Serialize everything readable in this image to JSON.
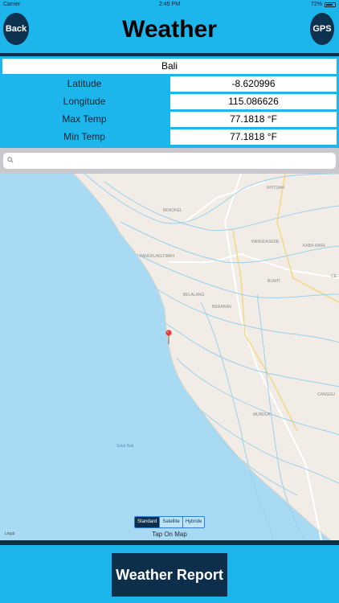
{
  "status_bar": {
    "carrier": "Carrier",
    "time": "2:45 PM",
    "battery": "72%"
  },
  "header": {
    "title": "Weather",
    "back_label": "Back",
    "gps_label": "GPS"
  },
  "location": {
    "name": "Bali"
  },
  "info": {
    "latitude": {
      "label": "Latitude",
      "value": "-8.620996"
    },
    "longitude": {
      "label": "Longitude",
      "value": "115.086626"
    },
    "max_temp": {
      "label": "Max Temp",
      "value": "77.1818 °F"
    },
    "min_temp": {
      "label": "Min Temp",
      "value": "77.1818 °F"
    }
  },
  "search": {
    "placeholder": ""
  },
  "map": {
    "places": [
      "BENOKEL",
      "PANGKUNGTIBAH",
      "BELALANG",
      "BERABAN",
      "NYITDAH",
      "PANGKAGEDE",
      "KABA KABA",
      "BUWIT",
      "MUNDUK",
      "CANGGU",
      "CE"
    ],
    "sea_label": "Selat Bali",
    "legal": "Legal",
    "map_types": [
      "Standard",
      "Satellite",
      "Hybride"
    ],
    "selected_type": "Standard",
    "hint": "Tap On Map"
  },
  "footer": {
    "report_label": "Weather Report"
  },
  "colors": {
    "background": "#1cb6ec",
    "dark": "#0d2f4c",
    "water": "#a9daf3",
    "land": "#f1ede6",
    "pin": "#e53935"
  }
}
